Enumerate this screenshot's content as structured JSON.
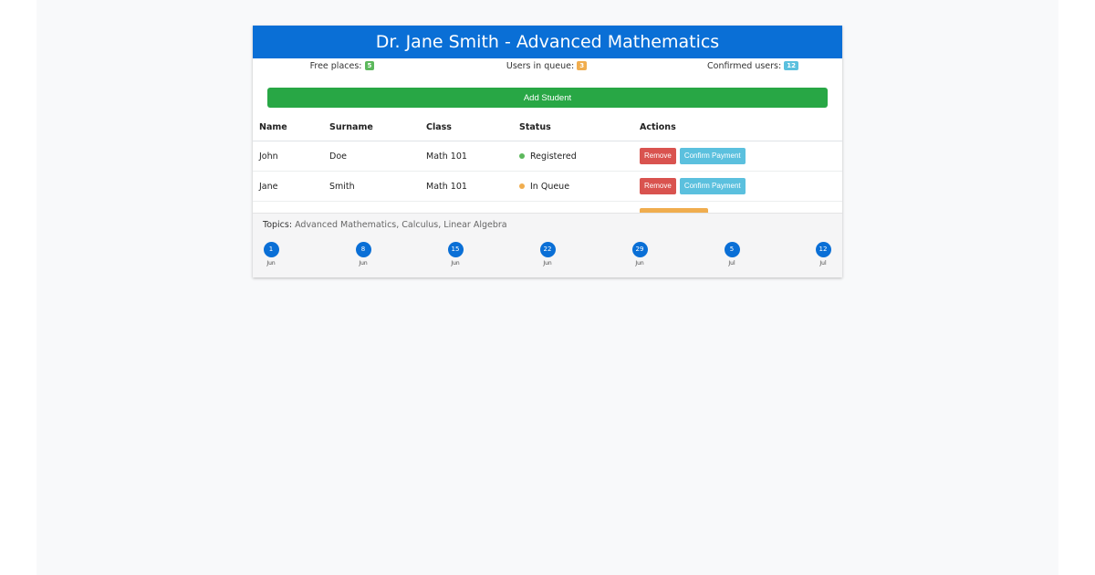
{
  "title": "Dr. Jane Smith - Advanced Mathematics",
  "stats": [
    {
      "label": "Free places:",
      "value": "5",
      "color": "#5cb85c"
    },
    {
      "label": "Users in queue:",
      "value": "3",
      "color": "#f0ad4e"
    },
    {
      "label": "Confirmed users:",
      "value": "12",
      "color": "#5bc0de"
    }
  ],
  "add_button": "Add Student",
  "table": {
    "headers": [
      "Name",
      "Surname",
      "Class",
      "Status",
      "Actions"
    ],
    "rows": [
      {
        "name": "John",
        "surname": "Doe",
        "class": "Math 101",
        "status": "Registered",
        "status_color": "#5cb85c",
        "actions": [
          "Remove",
          "Confirm Payment"
        ]
      },
      {
        "name": "Jane",
        "surname": "Smith",
        "class": "Math 101",
        "status": "In Queue",
        "status_color": "#f0ad4e",
        "actions": [
          "Remove",
          "Confirm Payment"
        ]
      }
    ]
  },
  "topics": {
    "label": "Topics:",
    "value": "Advanced Mathematics, Calculus, Linear Algebra"
  },
  "timeline": [
    {
      "day": "1",
      "month": "Jun"
    },
    {
      "day": "8",
      "month": "Jun"
    },
    {
      "day": "15",
      "month": "Jun"
    },
    {
      "day": "22",
      "month": "Jun"
    },
    {
      "day": "29",
      "month": "Jun"
    },
    {
      "day": "5",
      "month": "Jul"
    },
    {
      "day": "12",
      "month": "Jul"
    }
  ],
  "colors": {
    "primary": "#0a6fd6",
    "success": "#28a745",
    "danger": "#d9534f",
    "info": "#5bc0de",
    "warning": "#f0ad4e"
  }
}
